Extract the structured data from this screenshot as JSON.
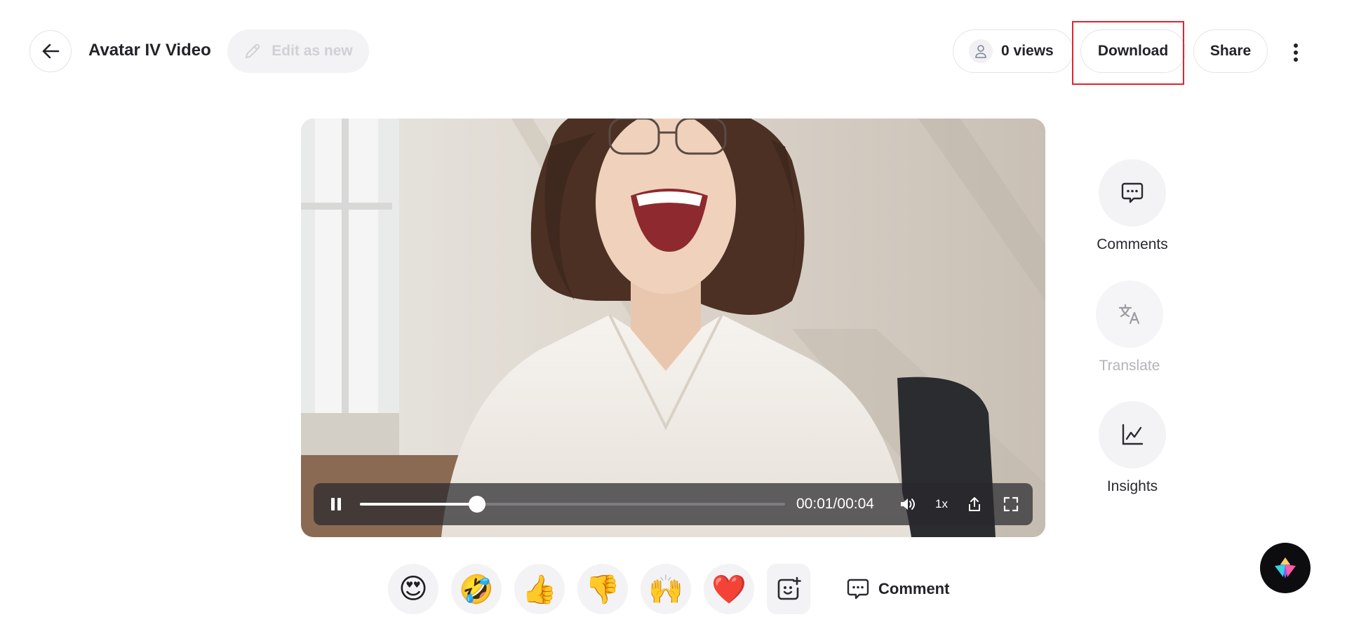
{
  "header": {
    "back_icon": "arrow-left-icon",
    "title": "Avatar IV Video",
    "edit_label": "Edit as new",
    "views_label": "0 views",
    "download_label": "Download",
    "share_label": "Share",
    "more_icon": "more-vertical-icon",
    "highlight_color": "#e0242f"
  },
  "player": {
    "time": "00:01/00:04",
    "speed": "1x",
    "progress": 0.275,
    "play_state": "playing",
    "icons": [
      "pause-icon",
      "volume-icon",
      "share-export-icon",
      "fullscreen-icon"
    ]
  },
  "side_actions": [
    {
      "label": "Comments",
      "icon": "comment-icon",
      "enabled": true
    },
    {
      "label": "Translate",
      "icon": "translate-icon",
      "enabled": false
    },
    {
      "label": "Insights",
      "icon": "chart-line-icon",
      "enabled": true
    }
  ],
  "reactions": [
    {
      "emoji": "😍",
      "name": "heart-eyes"
    },
    {
      "emoji": "🤣",
      "name": "rolling-laughing"
    },
    {
      "emoji": "👍",
      "name": "thumbs-up"
    },
    {
      "emoji": "👎",
      "name": "thumbs-down"
    },
    {
      "emoji": "🙌",
      "name": "raised-hands"
    },
    {
      "emoji": "❤️",
      "name": "red-heart"
    }
  ],
  "comment_label": "Comment"
}
